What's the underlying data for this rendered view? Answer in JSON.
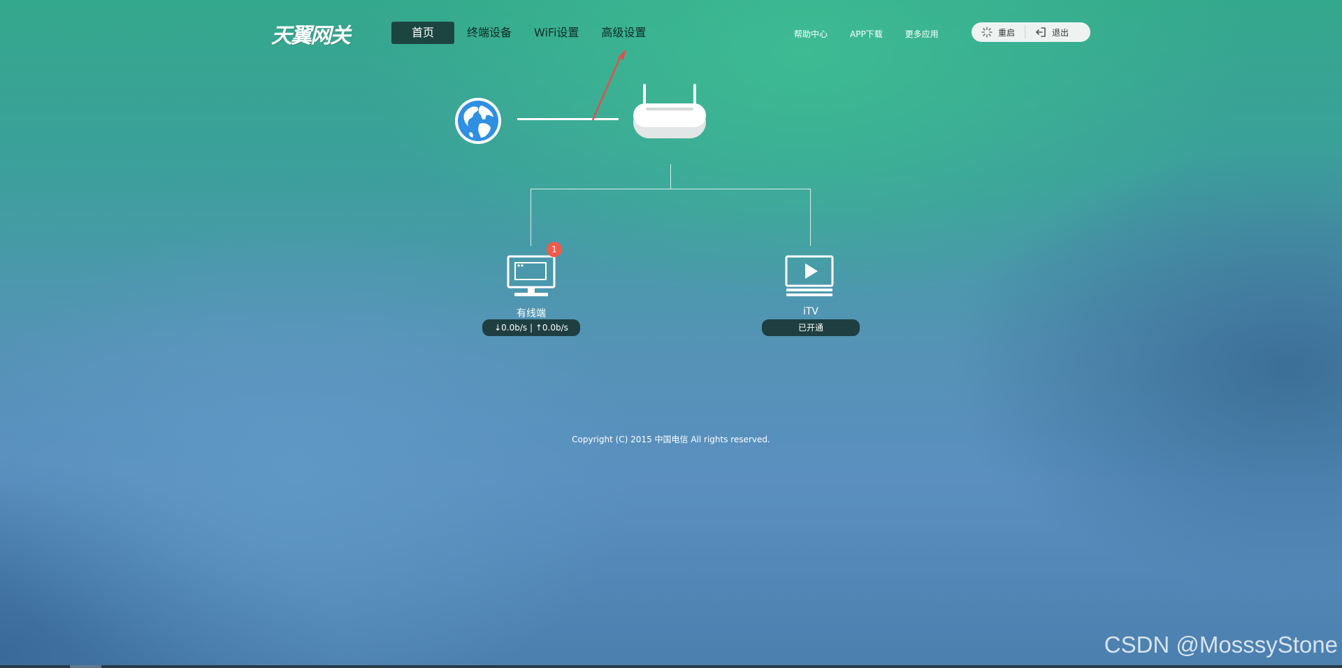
{
  "header": {
    "logo_text": "天翼网关",
    "nav": [
      {
        "label": "首页",
        "active": true
      },
      {
        "label": "终端设备",
        "active": false
      },
      {
        "label": "WiFi设置",
        "active": false
      },
      {
        "label": "高级设置",
        "active": false
      }
    ],
    "links": [
      "帮助中心",
      "APP下载",
      "更多应用"
    ],
    "restart_label": "重启",
    "logout_label": "退出"
  },
  "topology": {
    "wired": {
      "label": "有线端",
      "badge": "1",
      "status": "↓0.0b/s | ↑0.0b/s"
    },
    "itv": {
      "label": "iTV",
      "status": "已开通"
    }
  },
  "footer": {
    "copyright": "Copyright (C) 2015 中国电信 All rights reserved."
  },
  "watermark": "CSDN @MosssyStone",
  "colors": {
    "nav_active_bg": "#1c4541",
    "status_pill_bg": "#1f3e42",
    "badge": "#ef5b4b",
    "annotation_arrow": "#e0504f"
  }
}
